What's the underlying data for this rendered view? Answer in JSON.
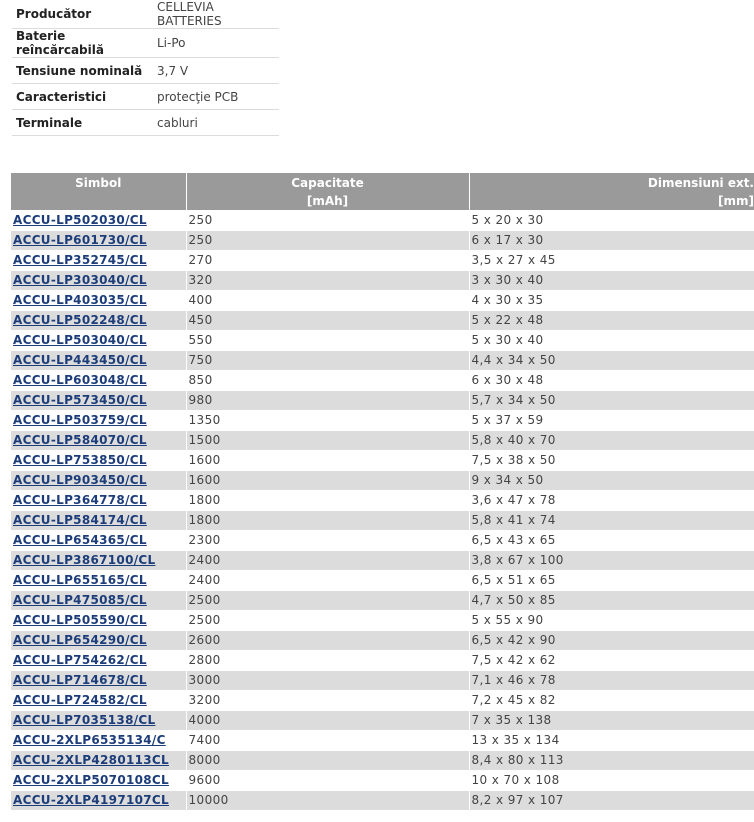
{
  "attributes": [
    {
      "label": "Producător",
      "value": "CELLEVIA BATTERIES"
    },
    {
      "label": "Baterie reîncărcabilă",
      "value": "Li-Po"
    },
    {
      "label": "Tensiune nominală",
      "value": "3,7 V"
    },
    {
      "label": "Caracteristici",
      "value": "protecţie PCB"
    },
    {
      "label": "Terminale",
      "value": "cabluri"
    }
  ],
  "table": {
    "headers": [
      "Simbol",
      "Capacitate",
      "Dimensiuni ext."
    ],
    "units": [
      "",
      "[mAh]",
      "[mm]"
    ],
    "rows": [
      {
        "symbol": "ACCU-LP502030/CL",
        "capacity": "250",
        "dims": "5 x 20 x 30"
      },
      {
        "symbol": "ACCU-LP601730/CL",
        "capacity": "250",
        "dims": "6 x 17 x 30"
      },
      {
        "symbol": "ACCU-LP352745/CL",
        "capacity": "270",
        "dims": "3,5 x 27 x 45"
      },
      {
        "symbol": "ACCU-LP303040/CL",
        "capacity": "320",
        "dims": "3 x 30 x 40"
      },
      {
        "symbol": "ACCU-LP403035/CL",
        "capacity": "400",
        "dims": "4 x 30 x 35"
      },
      {
        "symbol": "ACCU-LP502248/CL",
        "capacity": "450",
        "dims": "5 x 22 x 48"
      },
      {
        "symbol": "ACCU-LP503040/CL",
        "capacity": "550",
        "dims": "5 x 30 x 40"
      },
      {
        "symbol": "ACCU-LP443450/CL",
        "capacity": "750",
        "dims": "4,4 x 34 x 50"
      },
      {
        "symbol": "ACCU-LP603048/CL",
        "capacity": "850",
        "dims": "6 x 30 x 48"
      },
      {
        "symbol": "ACCU-LP573450/CL",
        "capacity": "980",
        "dims": "5,7 x 34 x 50"
      },
      {
        "symbol": "ACCU-LP503759/CL",
        "capacity": "1350",
        "dims": "5 x 37 x 59"
      },
      {
        "symbol": "ACCU-LP584070/CL",
        "capacity": "1500",
        "dims": "5,8 x 40 x 70"
      },
      {
        "symbol": "ACCU-LP753850/CL",
        "capacity": "1600",
        "dims": "7,5 x 38 x 50"
      },
      {
        "symbol": "ACCU-LP903450/CL",
        "capacity": "1600",
        "dims": "9 x 34 x 50"
      },
      {
        "symbol": "ACCU-LP364778/CL",
        "capacity": "1800",
        "dims": "3,6 x 47 x 78"
      },
      {
        "symbol": "ACCU-LP584174/CL",
        "capacity": "1800",
        "dims": "5,8 x 41 x 74"
      },
      {
        "symbol": "ACCU-LP654365/CL",
        "capacity": "2300",
        "dims": "6,5 x 43 x 65"
      },
      {
        "symbol": "ACCU-LP3867100/CL",
        "capacity": "2400",
        "dims": "3,8 x 67 x 100"
      },
      {
        "symbol": "ACCU-LP655165/CL",
        "capacity": "2400",
        "dims": "6,5 x 51 x 65"
      },
      {
        "symbol": "ACCU-LP475085/CL",
        "capacity": "2500",
        "dims": "4,7 x 50 x 85"
      },
      {
        "symbol": "ACCU-LP505590/CL",
        "capacity": "2500",
        "dims": "5 x 55 x 90"
      },
      {
        "symbol": "ACCU-LP654290/CL",
        "capacity": "2600",
        "dims": "6,5 x 42 x 90"
      },
      {
        "symbol": "ACCU-LP754262/CL",
        "capacity": "2800",
        "dims": "7,5 x 42 x 62"
      },
      {
        "symbol": "ACCU-LP714678/CL",
        "capacity": "3000",
        "dims": "7,1 x 46 x 78"
      },
      {
        "symbol": "ACCU-LP724582/CL",
        "capacity": "3200",
        "dims": "7,2 x 45 x 82"
      },
      {
        "symbol": "ACCU-LP7035138/CL",
        "capacity": "4000",
        "dims": "7 x 35 x 138"
      },
      {
        "symbol": "ACCU-2XLP6535134/C",
        "capacity": "7400",
        "dims": "13 x 35 x 134"
      },
      {
        "symbol": "ACCU-2XLP4280113CL",
        "capacity": "8000",
        "dims": "8,4 x 80 x 113"
      },
      {
        "symbol": "ACCU-2XLP5070108CL",
        "capacity": "9600",
        "dims": "10 x 70 x 108"
      },
      {
        "symbol": "ACCU-2XLP4197107CL",
        "capacity": "10000",
        "dims": "8,2 x 97 x 107"
      }
    ]
  }
}
